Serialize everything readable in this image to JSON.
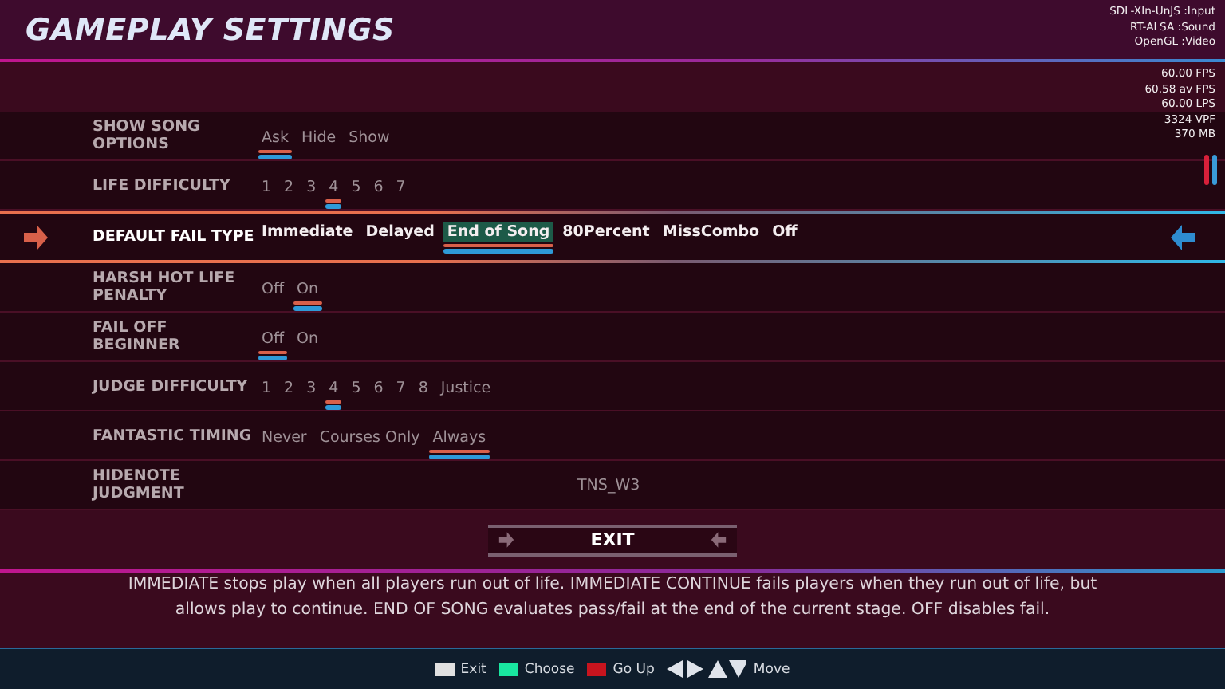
{
  "header": {
    "title": "GAMEPLAY SETTINGS"
  },
  "drivers": [
    "SDL-XIn-UnJS :Input",
    "RT-ALSA :Sound",
    "OpenGL :Video"
  ],
  "stats": [
    "60.00 FPS",
    "60.58 av FPS",
    "60.00 LPS",
    "3324 VPF",
    "370 MB"
  ],
  "rows": [
    {
      "kind": "choices",
      "label": "SHOW SONG OPTIONS",
      "active": false,
      "options": [
        {
          "text": "Ask",
          "selected": true,
          "highlighted": false
        },
        {
          "text": "Hide",
          "selected": false,
          "highlighted": false
        },
        {
          "text": "Show",
          "selected": false,
          "highlighted": false
        }
      ]
    },
    {
      "kind": "choices",
      "label": "LIFE DIFFICULTY",
      "active": false,
      "options": [
        {
          "text": "1",
          "selected": false,
          "highlighted": false
        },
        {
          "text": "2",
          "selected": false,
          "highlighted": false
        },
        {
          "text": "3",
          "selected": false,
          "highlighted": false
        },
        {
          "text": "4",
          "selected": true,
          "highlighted": false
        },
        {
          "text": "5",
          "selected": false,
          "highlighted": false
        },
        {
          "text": "6",
          "selected": false,
          "highlighted": false
        },
        {
          "text": "7",
          "selected": false,
          "highlighted": false
        }
      ]
    },
    {
      "kind": "choices",
      "label": "DEFAULT FAIL TYPE",
      "active": true,
      "options": [
        {
          "text": "Immediate",
          "selected": false,
          "highlighted": false
        },
        {
          "text": "Delayed",
          "selected": false,
          "highlighted": false
        },
        {
          "text": "End of Song",
          "selected": true,
          "highlighted": true
        },
        {
          "text": "80Percent",
          "selected": false,
          "highlighted": false
        },
        {
          "text": "MissCombo",
          "selected": false,
          "highlighted": false
        },
        {
          "text": "Off",
          "selected": false,
          "highlighted": false
        }
      ]
    },
    {
      "kind": "choices",
      "label": "HARSH HOT LIFE PENALTY",
      "active": false,
      "options": [
        {
          "text": "Off",
          "selected": false,
          "highlighted": false
        },
        {
          "text": "On",
          "selected": true,
          "highlighted": false
        }
      ]
    },
    {
      "kind": "choices",
      "label": "FAIL OFF BEGINNER",
      "active": false,
      "options": [
        {
          "text": "Off",
          "selected": true,
          "highlighted": false
        },
        {
          "text": "On",
          "selected": false,
          "highlighted": false
        }
      ]
    },
    {
      "kind": "choices",
      "label": "JUDGE DIFFICULTY",
      "active": false,
      "options": [
        {
          "text": "1",
          "selected": false,
          "highlighted": false
        },
        {
          "text": "2",
          "selected": false,
          "highlighted": false
        },
        {
          "text": "3",
          "selected": false,
          "highlighted": false
        },
        {
          "text": "4",
          "selected": true,
          "highlighted": false
        },
        {
          "text": "5",
          "selected": false,
          "highlighted": false
        },
        {
          "text": "6",
          "selected": false,
          "highlighted": false
        },
        {
          "text": "7",
          "selected": false,
          "highlighted": false
        },
        {
          "text": "8",
          "selected": false,
          "highlighted": false
        },
        {
          "text": "Justice",
          "selected": false,
          "highlighted": false
        }
      ]
    },
    {
      "kind": "choices",
      "label": "FANTASTIC TIMING",
      "active": false,
      "options": [
        {
          "text": "Never",
          "selected": false,
          "highlighted": false
        },
        {
          "text": "Courses Only",
          "selected": false,
          "highlighted": false
        },
        {
          "text": "Always",
          "selected": true,
          "highlighted": false
        }
      ]
    },
    {
      "kind": "value",
      "label": "HIDENOTE JUDGMENT",
      "active": false,
      "value": "TNS_W3"
    }
  ],
  "exit_button": {
    "label": "EXIT"
  },
  "description": "IMMEDIATE stops play when all players run out of life. IMMEDIATE CONTINUE fails players when they run out of life, but allows play to continue. END OF SONG evaluates pass/fail at the end of the current stage. OFF disables fail.",
  "legend": [
    {
      "kind": "swatch",
      "label": "Exit",
      "color": "#e0e0e0"
    },
    {
      "kind": "swatch",
      "label": "Choose",
      "color": "#19e6a0"
    },
    {
      "kind": "swatch",
      "label": "Go Up",
      "color": "#c8141e"
    },
    {
      "kind": "arrows",
      "label": "Move"
    }
  ]
}
